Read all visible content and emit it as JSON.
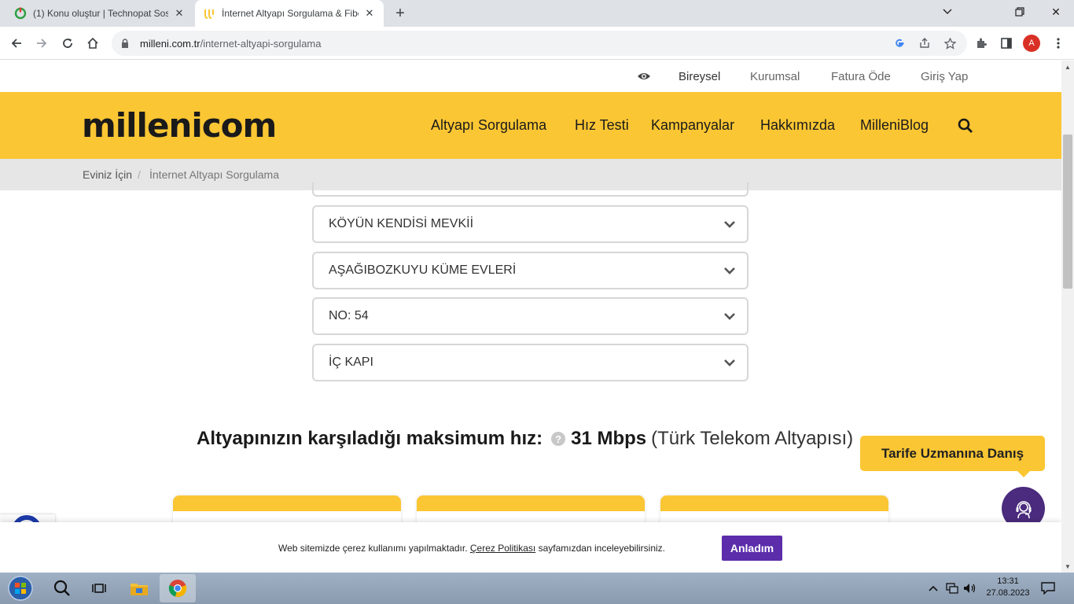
{
  "browser": {
    "tabs": [
      {
        "title": "(1) Konu oluştur | Technopat Sosyal",
        "active": false
      },
      {
        "title": "İnternet Altyapı Sorgulama & Fiber",
        "active": true
      }
    ],
    "url_host": "milleni.com.tr",
    "url_path": "/internet-altyapi-sorgulama",
    "profile_initial": "A"
  },
  "topnav": {
    "links": [
      "Bireysel",
      "Kurumsal",
      "Fatura Öde",
      "Giriş Yap"
    ]
  },
  "mainnav": {
    "logo": "millenicom",
    "items": [
      "Altyapı Sorgulama",
      "Hız Testi",
      "Kampanyalar",
      "Hakkımızda",
      "MilleniBlog"
    ]
  },
  "breadcrumb": {
    "home": "Eviniz İçin",
    "separator": "/",
    "current": "İnternet Altyapı Sorgulama"
  },
  "selects": [
    {
      "value": "KÖYÜN KENDİSİ MEVKİİ"
    },
    {
      "value": "AŞAĞIBOZKUYU KÜME EVLERİ"
    },
    {
      "value": "NO: 54"
    },
    {
      "value": "İÇ KAPI"
    }
  ],
  "result": {
    "label": "Altyapınızın karşıladığı maksimum hız:",
    "help": "?",
    "speed": "31 Mbps",
    "provider": "(Türk Telekom Altyapısı)"
  },
  "cookie": {
    "text_before": "Web sitemizde çerez kullanımı yapılmaktadır.",
    "link": "Çerez Politikası",
    "text_after": "sayfamızdan inceleyebilirsiniz.",
    "button": "Anladım"
  },
  "support": {
    "tooltip": "Tarife Uzmanına Danış"
  },
  "taskbar": {
    "time": "13:31",
    "date": "27.08.2023"
  },
  "colors": {
    "brand_yellow": "#fbc633",
    "brand_purple": "#5b2dab",
    "support_purple": "#4a2b7d"
  }
}
